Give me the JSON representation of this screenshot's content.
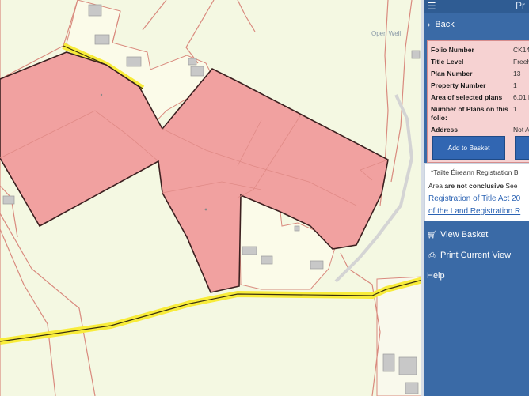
{
  "panel": {
    "title": "Pr",
    "back_label": "Back",
    "folio_info": [
      {
        "label": "Folio Number",
        "value": "CK14"
      },
      {
        "label": "Title Level",
        "value": "Freeh"
      },
      {
        "label": "Plan Number",
        "value": "13"
      },
      {
        "label": "Property Number",
        "value": "1"
      },
      {
        "label": "Area of selected plans",
        "value": "6.01 H"
      },
      {
        "label": "Number of Plans on this folio:",
        "value": "1"
      },
      {
        "label": "Address",
        "value": "Not A"
      }
    ],
    "add_to_basket_label": "Add to Basket",
    "notice": {
      "line1": "*Tailte Éireann Registration B",
      "line2_pre": "Area ",
      "line2_bold": "are not conclusive",
      "line2_post": " See",
      "link1": "Registration of Title Act 20",
      "link2": "of the Land Registration R"
    },
    "menu": [
      {
        "label": "View Basket",
        "icon": "cart-icon"
      },
      {
        "label": "Print Current View",
        "icon": "print-icon"
      },
      {
        "label": "Help",
        "icon": ""
      }
    ]
  },
  "map": {
    "label_open_well": "Open Well",
    "colors": {
      "background": "#f4f8e2",
      "parcel_fill": "#f1a1a0",
      "parcel_border": "#3c2020",
      "road_yellow": "#f8ec3a",
      "boundary_red": "#d98a7e",
      "building": "#c8c8c8"
    }
  }
}
